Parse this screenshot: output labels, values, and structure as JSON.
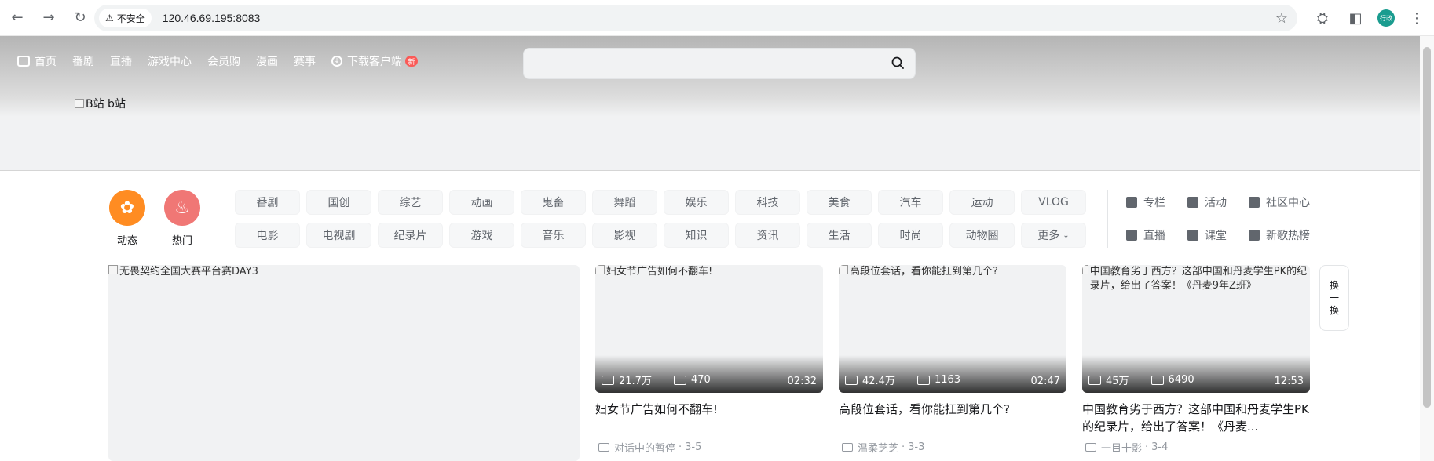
{
  "browser": {
    "security_label": "不安全",
    "url": "120.46.69.195:8083",
    "profile_label": "行政"
  },
  "header": {
    "nav": [
      "首页",
      "番剧",
      "直播",
      "游戏中心",
      "会员购",
      "漫画",
      "赛事"
    ],
    "download_label": "下载客户端",
    "new_badge": "新",
    "search_placeholder": "",
    "logo_alt": "B站 b站"
  },
  "channel": {
    "dynamic_label": "动态",
    "hot_label": "热门",
    "tags_row1": [
      "番剧",
      "国创",
      "综艺",
      "动画",
      "鬼畜",
      "舞蹈",
      "娱乐",
      "科技",
      "美食",
      "汽车",
      "运动",
      "VLOG"
    ],
    "tags_row2": [
      "电影",
      "电视剧",
      "纪录片",
      "游戏",
      "音乐",
      "影视",
      "知识",
      "资讯",
      "生活",
      "时尚",
      "动物圈",
      "更多"
    ],
    "side_links": [
      "专栏",
      "活动",
      "社区中心",
      "直播",
      "课堂",
      "新歌热榜"
    ]
  },
  "feed": {
    "hero_alt": "无畏契约全国大赛平台赛DAY3",
    "cards": [
      {
        "alt": "妇女节广告如何不翻车!",
        "views": "21.7万",
        "danmaku": "470",
        "duration": "02:32",
        "title": "妇女节广告如何不翻车!",
        "author": "对话中的暂停",
        "date": "3-5"
      },
      {
        "alt": "高段位套话，看你能扛到第几个?",
        "views": "42.4万",
        "danmaku": "1163",
        "duration": "02:47",
        "title": "高段位套话，看你能扛到第几个?",
        "author": "温柔芝芝",
        "date": "3-3"
      },
      {
        "alt": "中国教育劣于西方？这部中国和丹麦学生PK的纪录片，给出了答案！《丹麦9年Z班》",
        "views": "45万",
        "danmaku": "6490",
        "duration": "12:53",
        "title": "中国教育劣于西方？这部中国和丹麦学生PK的纪录片，给出了答案！《丹麦...",
        "author": "一目十影",
        "date": "3-4"
      }
    ],
    "refresh_top": "换",
    "refresh_bottom": "换"
  }
}
